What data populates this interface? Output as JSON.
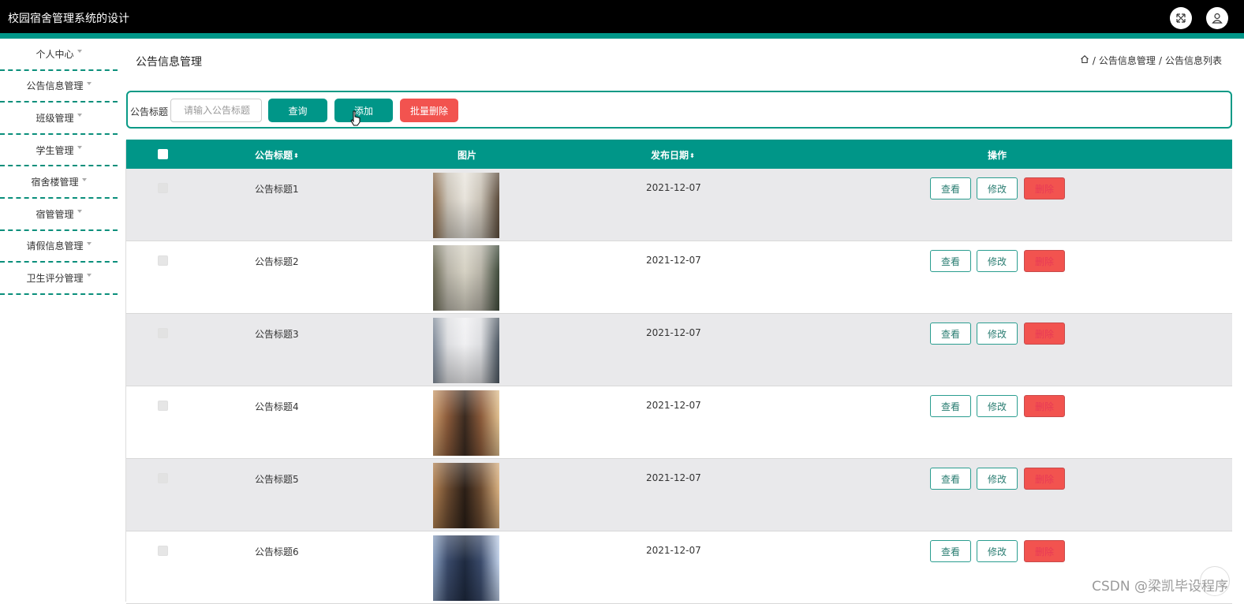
{
  "app": {
    "title": "校园宿舍管理系统的设计"
  },
  "topbar": {
    "icons": [
      "fullscreen-icon",
      "user-icon"
    ]
  },
  "sidebar": {
    "items": [
      {
        "label": "个人中心"
      },
      {
        "label": "公告信息管理"
      },
      {
        "label": "班级管理"
      },
      {
        "label": "学生管理"
      },
      {
        "label": "宿舍楼管理"
      },
      {
        "label": "宿管管理"
      },
      {
        "label": "请假信息管理"
      },
      {
        "label": "卫生评分管理"
      }
    ]
  },
  "page": {
    "title": "公告信息管理",
    "breadcrumb": [
      "公告信息管理",
      "公告信息列表"
    ]
  },
  "search": {
    "label": "公告标题",
    "placeholder": "请输入公告标题",
    "query_label": "查询",
    "add_label": "添加",
    "batch_delete_label": "批量删除"
  },
  "table": {
    "headers": {
      "title": "公告标题",
      "image": "图片",
      "date": "发布日期",
      "actions": "操作"
    },
    "sort_glyph": "⬍",
    "rows": [
      {
        "title": "公告标题1",
        "date": "2021-12-07"
      },
      {
        "title": "公告标题2",
        "date": "2021-12-07"
      },
      {
        "title": "公告标题3",
        "date": "2021-12-07"
      },
      {
        "title": "公告标题4",
        "date": "2021-12-07"
      },
      {
        "title": "公告标题5",
        "date": "2021-12-07"
      },
      {
        "title": "公告标题6",
        "date": "2021-12-07"
      }
    ],
    "actions": {
      "view": "查看",
      "edit": "修改",
      "delete": "删除"
    }
  },
  "watermark": "CSDN @梁凯毕设程序",
  "colors": {
    "accent": "#009688",
    "danger": "#f2534f",
    "topbar": "#000000"
  }
}
